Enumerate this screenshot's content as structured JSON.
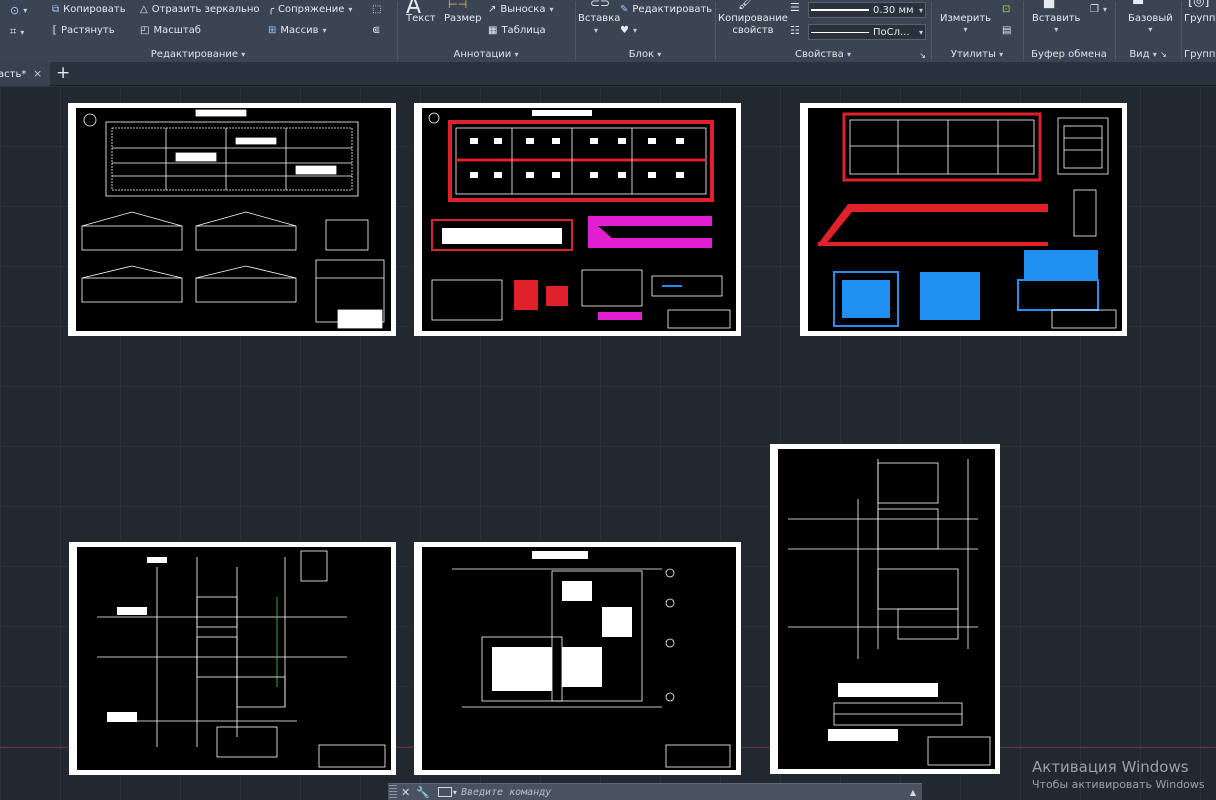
{
  "ribbon": {
    "modify": {
      "copy": "Копировать",
      "mirror": "Отразить зеркально",
      "fillet": "Сопряжение",
      "stretch": "Растянуть",
      "scale": "Масштаб",
      "array": "Массив",
      "title": "Редактирование"
    },
    "annotation": {
      "text": "Текст",
      "dimension": "Размер",
      "leader": "Выноска",
      "table": "Таблица",
      "title": "Аннотации"
    },
    "block": {
      "insert": "Вставка",
      "edit": "Редактировать",
      "title": "Блок"
    },
    "properties": {
      "match_line1": "Копирование",
      "match_line2": "свойств",
      "lineweight": "0.30 мм",
      "linetype": "ПоСл...",
      "title": "Свойства"
    },
    "utilities": {
      "measure": "Измерить",
      "title": "Утилиты"
    },
    "clipboard": {
      "paste": "Вставить",
      "title": "Буфер обмена"
    },
    "view": {
      "base": "Базовый",
      "title": "Вид"
    },
    "groups": {
      "group": "Группа",
      "title": "Групп"
    }
  },
  "tabs": {
    "active_doc": "асть*",
    "close_glyph": "×",
    "add_glyph": "+"
  },
  "command": {
    "placeholder": "Введите команду"
  },
  "watermark": {
    "line1": "Активация Windows",
    "line2": "Чтобы активировать Windows"
  },
  "colors": {
    "ribbon_bg": "#3b4453",
    "canvas_bg": "#212830",
    "red_markup": "#e0202a",
    "magenta_markup": "#e020d0",
    "blue_markup": "#1f8ff0"
  }
}
